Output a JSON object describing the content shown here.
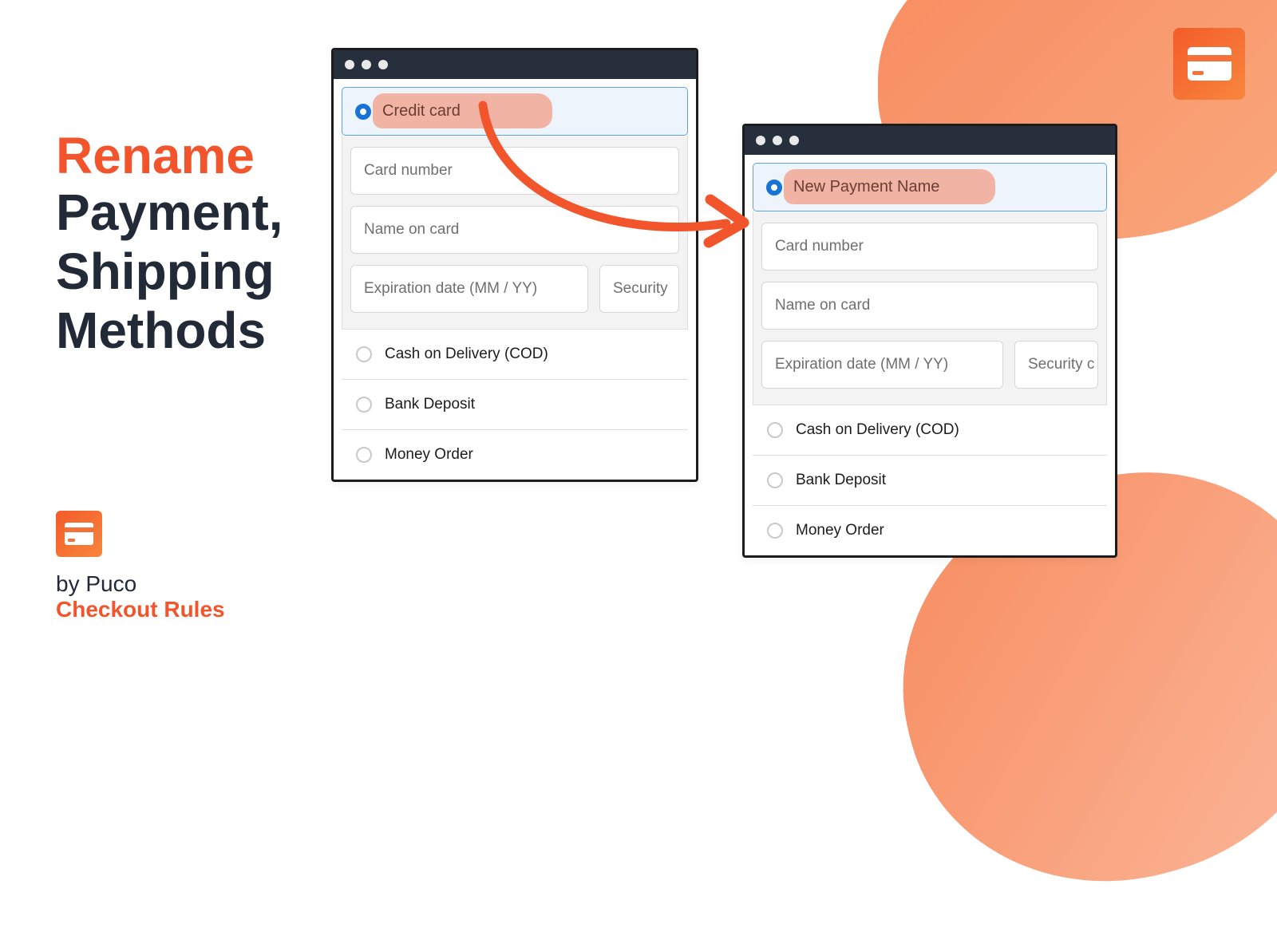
{
  "headline": {
    "accent": "Rename",
    "line2": "Payment,",
    "line3": "Shipping",
    "line4": "Methods"
  },
  "brand": {
    "line1": "by Puco",
    "line2": "Checkout Rules"
  },
  "windows": {
    "left": {
      "selected_label": "Credit card",
      "fields": {
        "card_number": "Card number",
        "name_on_card": "Name on card",
        "expiration": "Expiration date (MM / YY)",
        "security": "Security"
      },
      "methods": [
        "Cash on Delivery (COD)",
        "Bank Deposit",
        "Money Order"
      ]
    },
    "right": {
      "selected_label": "New Payment Name",
      "fields": {
        "card_number": "Card number",
        "name_on_card": "Name on card",
        "expiration": "Expiration date (MM / YY)",
        "security": "Security c"
      },
      "methods": [
        "Cash on Delivery (COD)",
        "Bank Deposit",
        "Money Order"
      ]
    }
  }
}
